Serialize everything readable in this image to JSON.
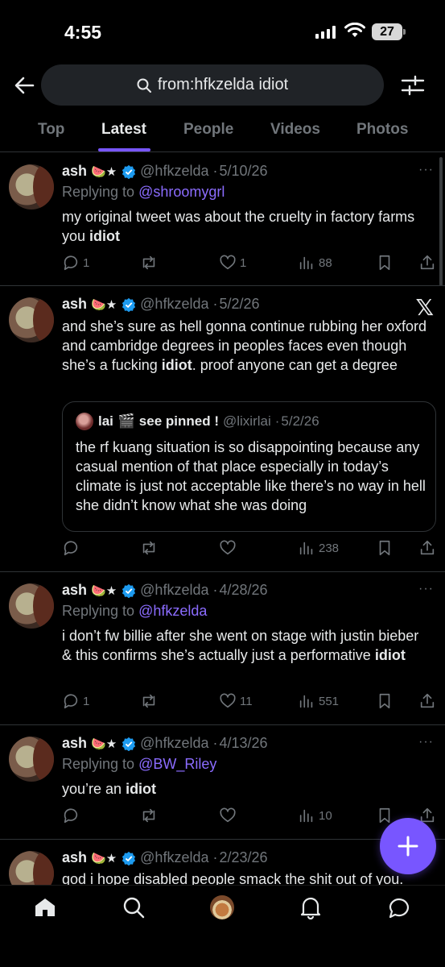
{
  "status_bar": {
    "time": "4:55",
    "battery": "27"
  },
  "search": {
    "query": "from:hfkzelda idiot"
  },
  "tabs": [
    {
      "label": "Top"
    },
    {
      "label": "Latest"
    },
    {
      "label": "People"
    },
    {
      "label": "Videos"
    },
    {
      "label": "Photos"
    }
  ],
  "active_tab": "Latest",
  "accent_color": "#7856ff",
  "tweets": [
    {
      "name": "ash",
      "emoji": "🍉★",
      "handle": "@hfkzelda",
      "date": "5/10/26",
      "replying_to_label": "Replying to",
      "replying_to": "@shroomygrl",
      "text_before": "my original tweet was about the cruelty in factory farms you ",
      "highlight": "idiot",
      "text_after": "",
      "replies": "1",
      "retweets": "",
      "likes": "1",
      "views": "88"
    },
    {
      "name": "ash",
      "emoji": "🍉★",
      "handle": "@hfkzelda",
      "date": "5/2/26",
      "text_before": "and she’s sure as hell gonna continue rubbing her oxford and cambridge degrees in peoples faces even though she’s a fucking ",
      "highlight": "idiot",
      "text_after": ". proof anyone can get a degree",
      "quote": {
        "name": "lai",
        "emoji": "🎬 see pinned !",
        "handle": "@lixirlai",
        "date": "5/2/26",
        "text": "the rf kuang situation is so disappointing because any casual mention of that place especially in today’s climate is just not acceptable like there’s no way in hell she didn’t know what she was doing"
      },
      "replies": "",
      "retweets": "",
      "likes": "",
      "views": "238"
    },
    {
      "name": "ash",
      "emoji": "🍉★",
      "handle": "@hfkzelda",
      "date": "4/28/26",
      "replying_to_label": "Replying to",
      "replying_to": "@hfkzelda",
      "text_before": "i don’t fw billie after she went on stage with justin bieber & this confirms she’s actually just a performative ",
      "highlight": "idiot",
      "text_after": "",
      "replies": "1",
      "retweets": "",
      "likes": "11",
      "views": "551"
    },
    {
      "name": "ash",
      "emoji": "🍉★",
      "handle": "@hfkzelda",
      "date": "4/13/26",
      "replying_to_label": "Replying to",
      "replying_to": "@BW_Riley",
      "text_before": "you’re an ",
      "highlight": "idiot",
      "text_after": "",
      "replies": "",
      "retweets": "",
      "likes": "",
      "views": "10"
    },
    {
      "name": "ash",
      "emoji": "🍉★",
      "handle": "@hfkzelda",
      "date": "2/23/26",
      "text_before": "god i hope disabled people smack the shit out of you.",
      "highlight": "",
      "text_after": ""
    }
  ],
  "icons": {
    "back": "arrow-left-icon",
    "search": "search-icon",
    "filter": "sliders-icon",
    "x_logo": "x-logo",
    "compose": "plus-icon",
    "nav": [
      "home-icon",
      "search-icon",
      "avatar",
      "bell-icon",
      "chat-icon"
    ]
  },
  "x_logo_glyph": "𝕏",
  "dot_separator": "·",
  "more_glyph": "···"
}
